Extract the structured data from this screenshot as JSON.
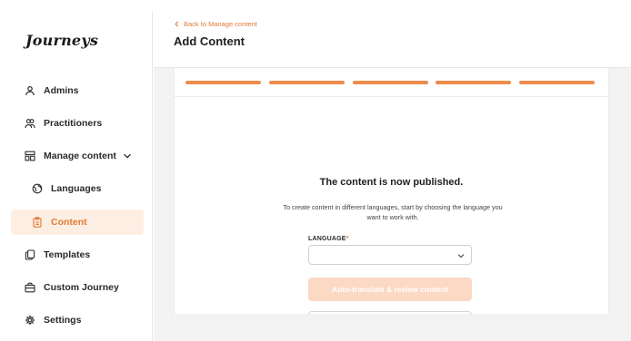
{
  "app": {
    "logo": "Journeys"
  },
  "sidebar": {
    "items": [
      {
        "label": "Admins",
        "icon": "user-icon"
      },
      {
        "label": "Practitioners",
        "icon": "users-icon"
      },
      {
        "label": "Manage content",
        "icon": "layout-icon"
      },
      {
        "label": "Languages",
        "icon": "globe-icon"
      },
      {
        "label": "Content",
        "icon": "clipboard-icon"
      },
      {
        "label": "Templates",
        "icon": "copy-icon"
      },
      {
        "label": "Custom Journey",
        "icon": "briefcase-icon"
      },
      {
        "label": "Settings",
        "icon": "gear-icon"
      }
    ],
    "active_item": "Content"
  },
  "header": {
    "back_link": "Back to Manage content",
    "title": "Add Content"
  },
  "wizard": {
    "steps_total": 5,
    "steps_completed": 5
  },
  "content": {
    "published_title": "The content is now published.",
    "description": "To create content in different languages, start by choosing the language you want to work with.",
    "language_label": "LANGUAGE",
    "required_marker": "*",
    "language_value": "",
    "auto_translate_button": "Auto-translate & review content"
  },
  "colors": {
    "accent": "#e07b35",
    "step_bar": "#ec8c4c",
    "active_bg": "#fdeee3",
    "disabled_button": "#fbd9c4"
  }
}
